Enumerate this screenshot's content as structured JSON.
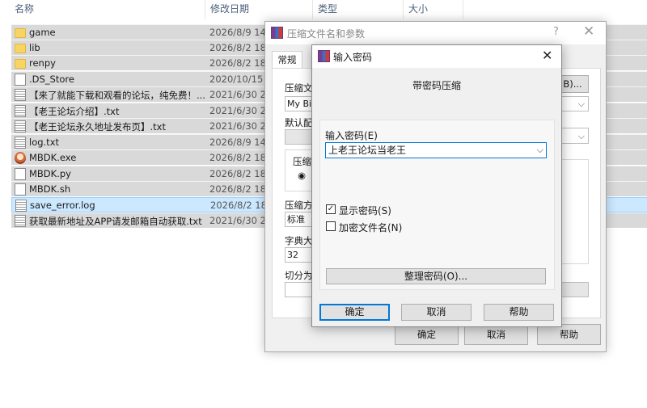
{
  "explorer": {
    "columns": {
      "name": "名称",
      "modified": "修改日期",
      "type": "类型",
      "size": "大小"
    },
    "sort_indicator": "^",
    "files": [
      {
        "name": "game",
        "date": "2026/8/9 14:",
        "icon": "folder-icon"
      },
      {
        "name": "lib",
        "date": "2026/8/2 18:",
        "icon": "folder-icon"
      },
      {
        "name": "renpy",
        "date": "2026/8/2 18:",
        "icon": "folder-icon"
      },
      {
        "name": ".DS_Store",
        "date": "2020/10/15 2",
        "icon": "file-icon"
      },
      {
        "name": "【来了就能下载和观看的论坛，纯免费！...",
        "date": "2021/6/30 22",
        "icon": "text-file-icon"
      },
      {
        "name": "【老王论坛介绍】.txt",
        "date": "2021/6/30 22",
        "icon": "text-file-icon"
      },
      {
        "name": "【老王论坛永久地址发布页】.txt",
        "date": "2021/6/30 22",
        "icon": "text-file-icon"
      },
      {
        "name": "log.txt",
        "date": "2026/8/9 14:",
        "icon": "text-file-icon"
      },
      {
        "name": "MBDK.exe",
        "date": "2026/8/2 18:",
        "icon": "exe-icon"
      },
      {
        "name": "MBDK.py",
        "date": "2026/8/2 18:",
        "icon": "file-icon"
      },
      {
        "name": "MBDK.sh",
        "date": "2026/8/2 18:",
        "icon": "file-icon"
      },
      {
        "name": "save_error.log",
        "date": "2026/8/2 18:",
        "icon": "text-file-icon"
      },
      {
        "name": "获取最新地址及APP请发邮箱自动获取.txt",
        "date": "2021/6/30 22",
        "icon": "text-file-icon"
      }
    ]
  },
  "archive_dialog": {
    "title": "压缩文件名和参数",
    "help": "?",
    "close": "✕",
    "tab_general": "常规",
    "archive_name_label": "压缩文",
    "archive_name_value": "My Bim",
    "browse_label": "B)...",
    "profile_label": "默认配",
    "format_label": "压缩",
    "format_radio": "◉ ",
    "method_label": "压缩方",
    "method_value": "标准",
    "dict_label": "字典大",
    "dict_value": "32",
    "split_label": "切分为",
    "ok": "确定",
    "cancel": "取消",
    "help_button": "帮助"
  },
  "password_dialog": {
    "title": "输入密码",
    "close": "✕",
    "heading": "带密码压缩",
    "password_label": "输入密码(E)",
    "password_value": "上老王论坛当老王",
    "show_password": {
      "label": "显示密码(S)",
      "checked": true
    },
    "encrypt_names": {
      "label": "加密文件名(N)",
      "checked": false
    },
    "manage_button": "整理密码(O)...",
    "ok": "确定",
    "cancel": "取消",
    "help": "帮助"
  },
  "icons": {
    "chevron": "⌵",
    "check": "✓"
  }
}
